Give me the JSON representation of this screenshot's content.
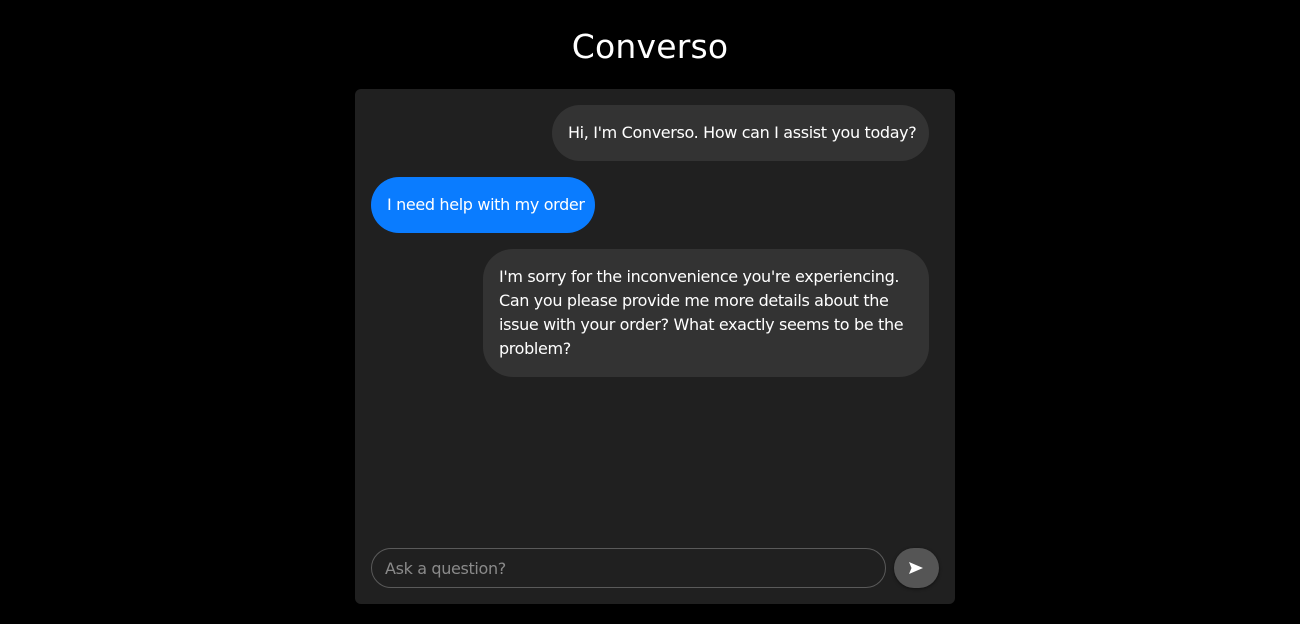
{
  "app": {
    "title": "Converso"
  },
  "messages": [
    {
      "sender": "bot",
      "text": "Hi, I'm Converso. How can I assist you today?"
    },
    {
      "sender": "user",
      "text": "I need help with my order"
    },
    {
      "sender": "bot",
      "lines": [
        "I'm sorry for the inconvenience you're experiencing.",
        "Can you please provide me more details about the",
        "issue with your order? What exactly seems to be the",
        "problem?"
      ]
    }
  ],
  "composer": {
    "placeholder": "Ask a question?",
    "value": "",
    "send_icon": "send-icon"
  },
  "colors": {
    "background": "#000000",
    "panel": "#202020",
    "bot_bubble": "#333333",
    "user_bubble": "#0a7cff",
    "send_button": "#555555"
  }
}
